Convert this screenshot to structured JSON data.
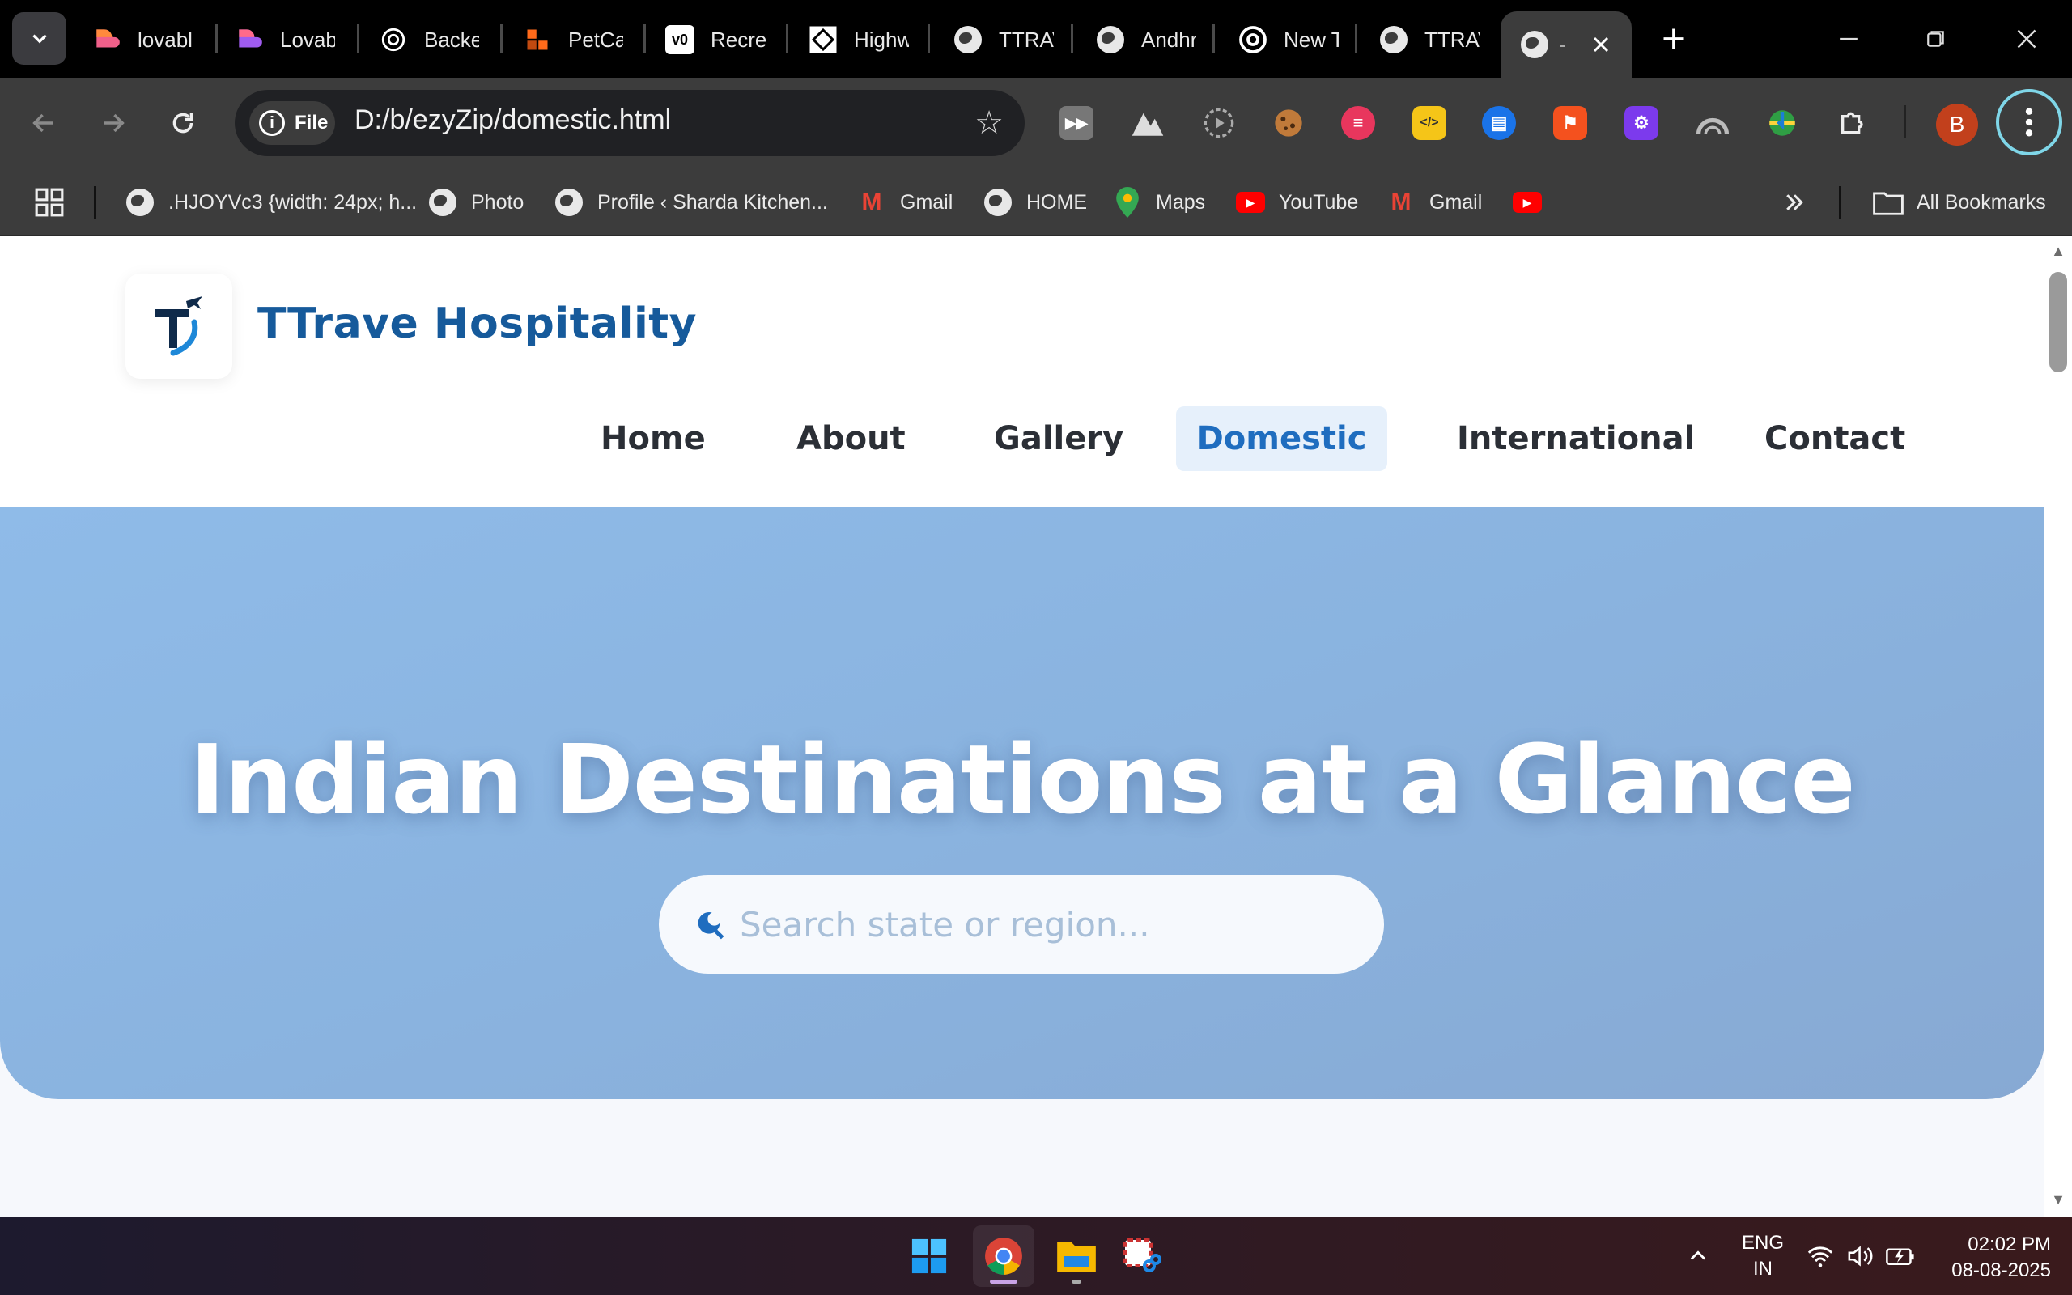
{
  "browser": {
    "tabs": [
      {
        "title": "lovabl",
        "icon": "lovable-icon"
      },
      {
        "title": "Lovab",
        "icon": "lovable-icon"
      },
      {
        "title": "Backe",
        "icon": "openai-icon"
      },
      {
        "title": "PetCa",
        "icon": "petcare-icon"
      },
      {
        "title": "Recrea",
        "icon": "v0-icon"
      },
      {
        "title": "Highw",
        "icon": "highway-icon"
      },
      {
        "title": "TTRAV",
        "icon": "globe-icon"
      },
      {
        "title": "Andhr",
        "icon": "globe-icon"
      },
      {
        "title": "New T",
        "icon": "chrome-icon"
      },
      {
        "title": "TTRAV",
        "icon": "globe-icon"
      },
      {
        "title": "-",
        "icon": "globe-icon",
        "active": true
      }
    ],
    "address": {
      "chip": "File",
      "url": "D:/b/ezyZip/domestic.html"
    },
    "profile_initial": "B",
    "bookmarks": [
      {
        "label": ".HJOYVc3 {width: 24px; h...",
        "icon": "globe-icon"
      },
      {
        "label": "Photo",
        "icon": "globe-icon"
      },
      {
        "label": "Profile ‹ Sharda Kitchen...",
        "icon": "globe-icon"
      },
      {
        "label": "Gmail",
        "icon": "gmail-icon"
      },
      {
        "label": "HOME",
        "icon": "globe-icon"
      },
      {
        "label": "Maps",
        "icon": "maps-icon"
      },
      {
        "label": "YouTube",
        "icon": "youtube-icon"
      },
      {
        "label": "Gmail",
        "icon": "gmail-icon"
      },
      {
        "label": "",
        "icon": "youtube-icon"
      }
    ],
    "all_bookmarks": "All Bookmarks"
  },
  "site": {
    "brand": "TTrave Hospitality",
    "nav": [
      {
        "label": "Home"
      },
      {
        "label": "About"
      },
      {
        "label": "Gallery"
      },
      {
        "label": "Domestic",
        "active": true
      },
      {
        "label": "International"
      },
      {
        "label": "Contact"
      }
    ],
    "hero": {
      "title": "Indian Destinations at a Glance",
      "search_placeholder": "Search state or region..."
    },
    "colors": {
      "brand": "#165a9b",
      "active_nav": "#1f6dbf",
      "hero": "#8ab3df"
    }
  },
  "taskbar": {
    "lang": "ENG",
    "region": "IN",
    "time": "02:02 PM",
    "date": "08-08-2025"
  }
}
